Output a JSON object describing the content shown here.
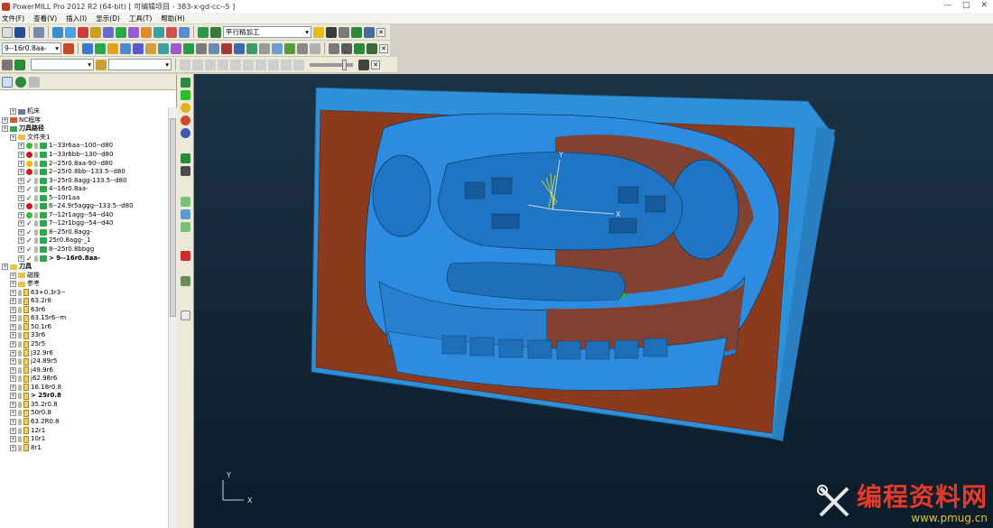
{
  "window": {
    "title": "PowerMILL Pro 2012 R2 (64-bit)  [ 可编辑项目 - 383-x-gd-cc--5 ]",
    "controls": [
      "—",
      "□",
      "✕"
    ]
  },
  "menu": [
    "文件(F)",
    "查看(V)",
    "插入(I)",
    "显示(D)",
    "工具(T)",
    "帮助(H)"
  ],
  "toolbar1": {
    "strategy_combo": "平行精加工"
  },
  "toolbar2": {
    "tool_combo": "9--16r0.8aa-"
  },
  "explorer": {
    "rows": [
      {
        "text": "机床",
        "indent": 1,
        "kind": "machine"
      },
      {
        "text": "NC程序",
        "indent": 0,
        "kind": "nc"
      },
      {
        "text": "刀具路径",
        "indent": 0,
        "kind": "paths",
        "bold": true
      },
      {
        "text": "文件夹1",
        "indent": 1,
        "kind": "folder"
      },
      {
        "text": "1--33r6aa--100--d80",
        "indent": 2,
        "kind": "path",
        "status": "#2fbf2f"
      },
      {
        "text": "1--33r6bb--130--d80",
        "indent": 2,
        "kind": "path",
        "status": "#d01a1a"
      },
      {
        "text": "2--25r0.8aa-90--d80",
        "indent": 2,
        "kind": "path",
        "status": "#e8c000"
      },
      {
        "text": "2--25r0.8bb--133.5--d80",
        "indent": 2,
        "kind": "path",
        "status": "#d01a1a"
      },
      {
        "text": "3--25r0.8agg-133.5--d80",
        "indent": 2,
        "kind": "path",
        "status": "check"
      },
      {
        "text": "4--16r0.8aa-",
        "indent": 2,
        "kind": "path",
        "status": "check"
      },
      {
        "text": "5--10r1aa",
        "indent": 2,
        "kind": "path",
        "status": "check"
      },
      {
        "text": "6--24.9r5aggg--133.5--d80",
        "indent": 2,
        "kind": "path",
        "status": "#d01a1a"
      },
      {
        "text": "7--12r1agg--54--d40",
        "indent": 2,
        "kind": "path",
        "status": "#2fbf2f"
      },
      {
        "text": "7--12r1bgg--54--d40",
        "indent": 2,
        "kind": "path",
        "status": "check"
      },
      {
        "text": "8--25r0.8agg-",
        "indent": 2,
        "kind": "path",
        "status": "check"
      },
      {
        "text": "25r0.8agg-_1",
        "indent": 2,
        "kind": "path",
        "status": "check"
      },
      {
        "text": "8--25r0.8bbgg",
        "indent": 2,
        "kind": "path",
        "status": "check"
      },
      {
        "text": "> 9--16r0.8aa-",
        "indent": 2,
        "kind": "path",
        "status": "check",
        "bold": true
      },
      {
        "text": "刀具",
        "indent": 0,
        "kind": "tools",
        "bold": true
      },
      {
        "text": "磁橡",
        "indent": 1,
        "kind": "folder"
      },
      {
        "text": "参考",
        "indent": 1,
        "kind": "folder"
      },
      {
        "text": "63+0.3r3--",
        "indent": 1,
        "kind": "tool"
      },
      {
        "text": "63.2r8",
        "indent": 1,
        "kind": "tool"
      },
      {
        "text": "63r6",
        "indent": 1,
        "kind": "tool"
      },
      {
        "text": "63.15r6--m",
        "indent": 1,
        "kind": "tool"
      },
      {
        "text": "50.1r6",
        "indent": 1,
        "kind": "tool"
      },
      {
        "text": "33r6",
        "indent": 1,
        "kind": "tool"
      },
      {
        "text": "25r5",
        "indent": 1,
        "kind": "tool"
      },
      {
        "text": "j32.9r6",
        "indent": 1,
        "kind": "tool"
      },
      {
        "text": "j24.89r5",
        "indent": 1,
        "kind": "tool"
      },
      {
        "text": "j49.9r6",
        "indent": 1,
        "kind": "tool"
      },
      {
        "text": "j62.98r6",
        "indent": 1,
        "kind": "tool"
      },
      {
        "text": "16.18r0.8",
        "indent": 1,
        "kind": "tool"
      },
      {
        "text": "> 25r0.8",
        "indent": 1,
        "kind": "tool",
        "bold": true
      },
      {
        "text": "35.2r0.8",
        "indent": 1,
        "kind": "tool"
      },
      {
        "text": "50r0.8",
        "indent": 1,
        "kind": "tool"
      },
      {
        "text": "63.2R0.8",
        "indent": 1,
        "kind": "tool"
      },
      {
        "text": "12r1",
        "indent": 1,
        "kind": "tool"
      },
      {
        "text": "10r1",
        "indent": 1,
        "kind": "tool"
      },
      {
        "text": "8r1",
        "indent": 1,
        "kind": "tool"
      }
    ]
  },
  "viewport": {
    "axis_x": "X",
    "axis_y": "Y",
    "triad_x": "X",
    "triad_y": "Y",
    "colors": {
      "background": "#122636",
      "model_blue": "#2e8ce0",
      "model_brown": "#8c3a1e",
      "block_blue": "#2e90d8"
    }
  },
  "watermark": {
    "title": "编程资料网",
    "url": "www.pmug.cn"
  }
}
